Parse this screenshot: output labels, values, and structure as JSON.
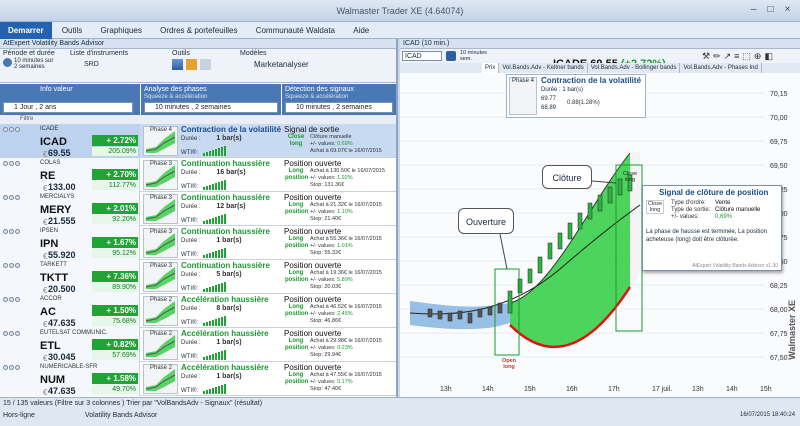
{
  "window": {
    "title": "Walmaster Trader XE  (4.64074)"
  },
  "menu": {
    "items": [
      "Demarrer",
      "Outils",
      "Graphiques",
      "Ordres & portefeuilles",
      "Communauté Waldata",
      "Aide"
    ]
  },
  "left_panel": {
    "title": "AtExpert Volatility Bands Advisor",
    "ribbon": {
      "period_label": "Période et durée",
      "period_value": "10 minutes sur 2 semaines",
      "list_label": "Liste d'instruments",
      "list_value": "SRD",
      "tools_label": "Outils",
      "models_label": "Modèles",
      "models_value": "Marketanalyser"
    },
    "columns": [
      {
        "label": "Info valeur",
        "sub": "",
        "select": "1 Jour , 2 ans"
      },
      {
        "label": "Analyse des phases",
        "sub": "Squeeze & accélération",
        "select": "10 minutes , 2 semaines"
      },
      {
        "label": "Détection des signaux",
        "sub": "Squeeze & accélération",
        "select": "10 minutes , 2 semaines"
      }
    ],
    "filter_label": "Filtre",
    "rows": [
      {
        "name": "ICADE",
        "ticker": "ICAD",
        "price": "69.55",
        "var": "+ 2.72%",
        "perf": "205.09%",
        "phase": "Phase 4",
        "phase_title": "Contraction de la volatilité",
        "duration": "1 bar(s)",
        "signal": "Signal de sortie",
        "signal_type": "Clôture manuelle",
        "signal_var": "0.69%",
        "signal_close": "Achat à 69.07€ le 16/07/2015",
        "sig_btn": "Close long",
        "title_color": "#1a4c8a",
        "selected": true
      },
      {
        "name": "COLAS",
        "ticker": "RE",
        "price": "133.00",
        "var": "+ 2.70%",
        "perf": "112.77%",
        "phase": "Phase 3",
        "phase_title": "Continuation haussière",
        "duration": "16 bar(s)",
        "signal": "Position ouverte",
        "signal_type": "Achat à 130.50€ le 16/07/2015",
        "signal_var": "1.92%",
        "signal_close": "Stop: 131.36€",
        "sig_btn": "Long position",
        "title_color": "#1a9a30",
        "selected": false
      },
      {
        "name": "MERCIALYS",
        "ticker": "MERY",
        "price": "21.555",
        "var": "+ 2.01%",
        "perf": "92.20%",
        "phase": "Phase 3",
        "phase_title": "Continuation haussière",
        "duration": "12 bar(s)",
        "signal": "Position ouverte",
        "signal_type": "Achat à 21.32€ le 16/07/2015",
        "signal_var": "1.10%",
        "signal_close": "Stop: 21.40€",
        "sig_btn": "Long position",
        "title_color": "#1a9a30",
        "selected": false
      },
      {
        "name": "IPSEN",
        "ticker": "IPN",
        "price": "55.920",
        "var": "+ 1.67%",
        "perf": "95.12%",
        "phase": "Phase 3",
        "phase_title": "Continuation haussière",
        "duration": "1 bar(s)",
        "signal": "Position ouverte",
        "signal_type": "Achat à 55.36€ le 16/07/2015",
        "signal_var": "1.01%",
        "signal_close": "Stop: 55.32€",
        "sig_btn": "Long position",
        "title_color": "#1a9a30",
        "selected": false
      },
      {
        "name": "TARKETT",
        "ticker": "TKTT",
        "price": "20.500",
        "var": "+ 7.36%",
        "perf": "89.90%",
        "phase": "Phase 3",
        "phase_title": "Continuation haussière",
        "duration": "5 bar(s)",
        "signal": "Position ouverte",
        "signal_type": "Achat à 19.36€ le 16/07/2015",
        "signal_var": "5.89%",
        "signal_close": "Stop: 20.03€",
        "sig_btn": "Long position",
        "title_color": "#1a9a30",
        "selected": false
      },
      {
        "name": "ACCOR",
        "ticker": "AC",
        "price": "47.635",
        "var": "+ 1.50%",
        "perf": "75.68%",
        "phase": "Phase 2",
        "phase_title": "Accélération haussière",
        "duration": "8 bar(s)",
        "signal": "Position ouverte",
        "signal_type": "Achat à 46.52€ le 16/07/2015",
        "signal_var": "2.45%",
        "signal_close": "Stop: 46.86€",
        "sig_btn": "Long position",
        "title_color": "#1a9a30",
        "selected": false
      },
      {
        "name": "EUTELSAT COMMUNIC.",
        "ticker": "ETL",
        "price": "30.045",
        "var": "+ 0.82%",
        "perf": "57.69%",
        "phase": "Phase 2",
        "phase_title": "Accélération haussière",
        "duration": "1 bar(s)",
        "signal": "Position ouverte",
        "signal_type": "Achat à 29.98€ le 16/07/2015",
        "signal_var": "0.23%",
        "signal_close": "Stop: 29.94€",
        "sig_btn": "Long position",
        "title_color": "#1a9a30",
        "selected": false
      },
      {
        "name": "NUMERICABLE-SFR",
        "ticker": "NUM",
        "price": "47.635",
        "var": "+ 1.58%",
        "perf": "49.70%",
        "phase": "Phase 2",
        "phase_title": "Accélération haussière",
        "duration": "1 bar(s)",
        "signal": "Position ouverte",
        "signal_type": "Achat à 47.55€ le 16/07/2015",
        "signal_var": "0.17%",
        "signal_close": "Stop: 47.40€",
        "sig_btn": "Long position",
        "title_color": "#1a9a30",
        "selected": false
      }
    ]
  },
  "right_panel": {
    "title": "ICAD (10 min.)",
    "symbol": "ICAD",
    "period": "10 minutes sem.",
    "price_header": "ICADE 69.55",
    "pct_header": "(+2,72%)",
    "tabs": [
      "Prix",
      "Vol.Bands.Adv - Keltner bands",
      "Vol.Bands.Adv - Bollinger bands",
      "Vol.Bands.Adv - Phases Ind"
    ],
    "phase_box": {
      "phase": "Phase 4",
      "title": "Contraction de la volatilité",
      "duration": "1 bar(s)",
      "v1": "69.77",
      "v2": "68.89",
      "pct": "0.88(1.28%)"
    },
    "y_ticks": [
      "70,15",
      "70,00",
      "69,75",
      "69,50",
      "69,25",
      "69,00",
      "68,75",
      "68,50",
      "68,25",
      "68,00",
      "67,75",
      "67,50"
    ],
    "x_ticks": [
      "13h",
      "14h",
      "15h",
      "16h",
      "17h",
      "17 juil.",
      "13h",
      "14h",
      "15h",
      "16h",
      "17h"
    ],
    "callouts": {
      "open": "Ouverture",
      "close": "Clôture",
      "open_long": "Open long",
      "close_long": "Close long"
    },
    "signal_panel": {
      "title": "Signal de clôture de position",
      "btn": "Close long",
      "k1": "Type d'ordre:",
      "v1": "Vente",
      "k2": "Type de sortie:",
      "v2": "Clôture manuelle",
      "k3": "+/- values:",
      "v3": "0,69%",
      "note": "La phase de hausse est terminée, La position acheteuse (long) doit être clôturée.",
      "footer": "AtExpert Volatility Bands Advisor v1.30"
    }
  },
  "status": {
    "count": "15 / 135 valeurs (Filtre sur 3 colonnes ) Trier par \"VolBandsAdv - Signaux\" (résultat)",
    "offline": "Hors-ligne",
    "module": "Volatility Bands Advisor",
    "datetime": "16/07/2015 18:40:24"
  },
  "brand": "Walmaster XE"
}
